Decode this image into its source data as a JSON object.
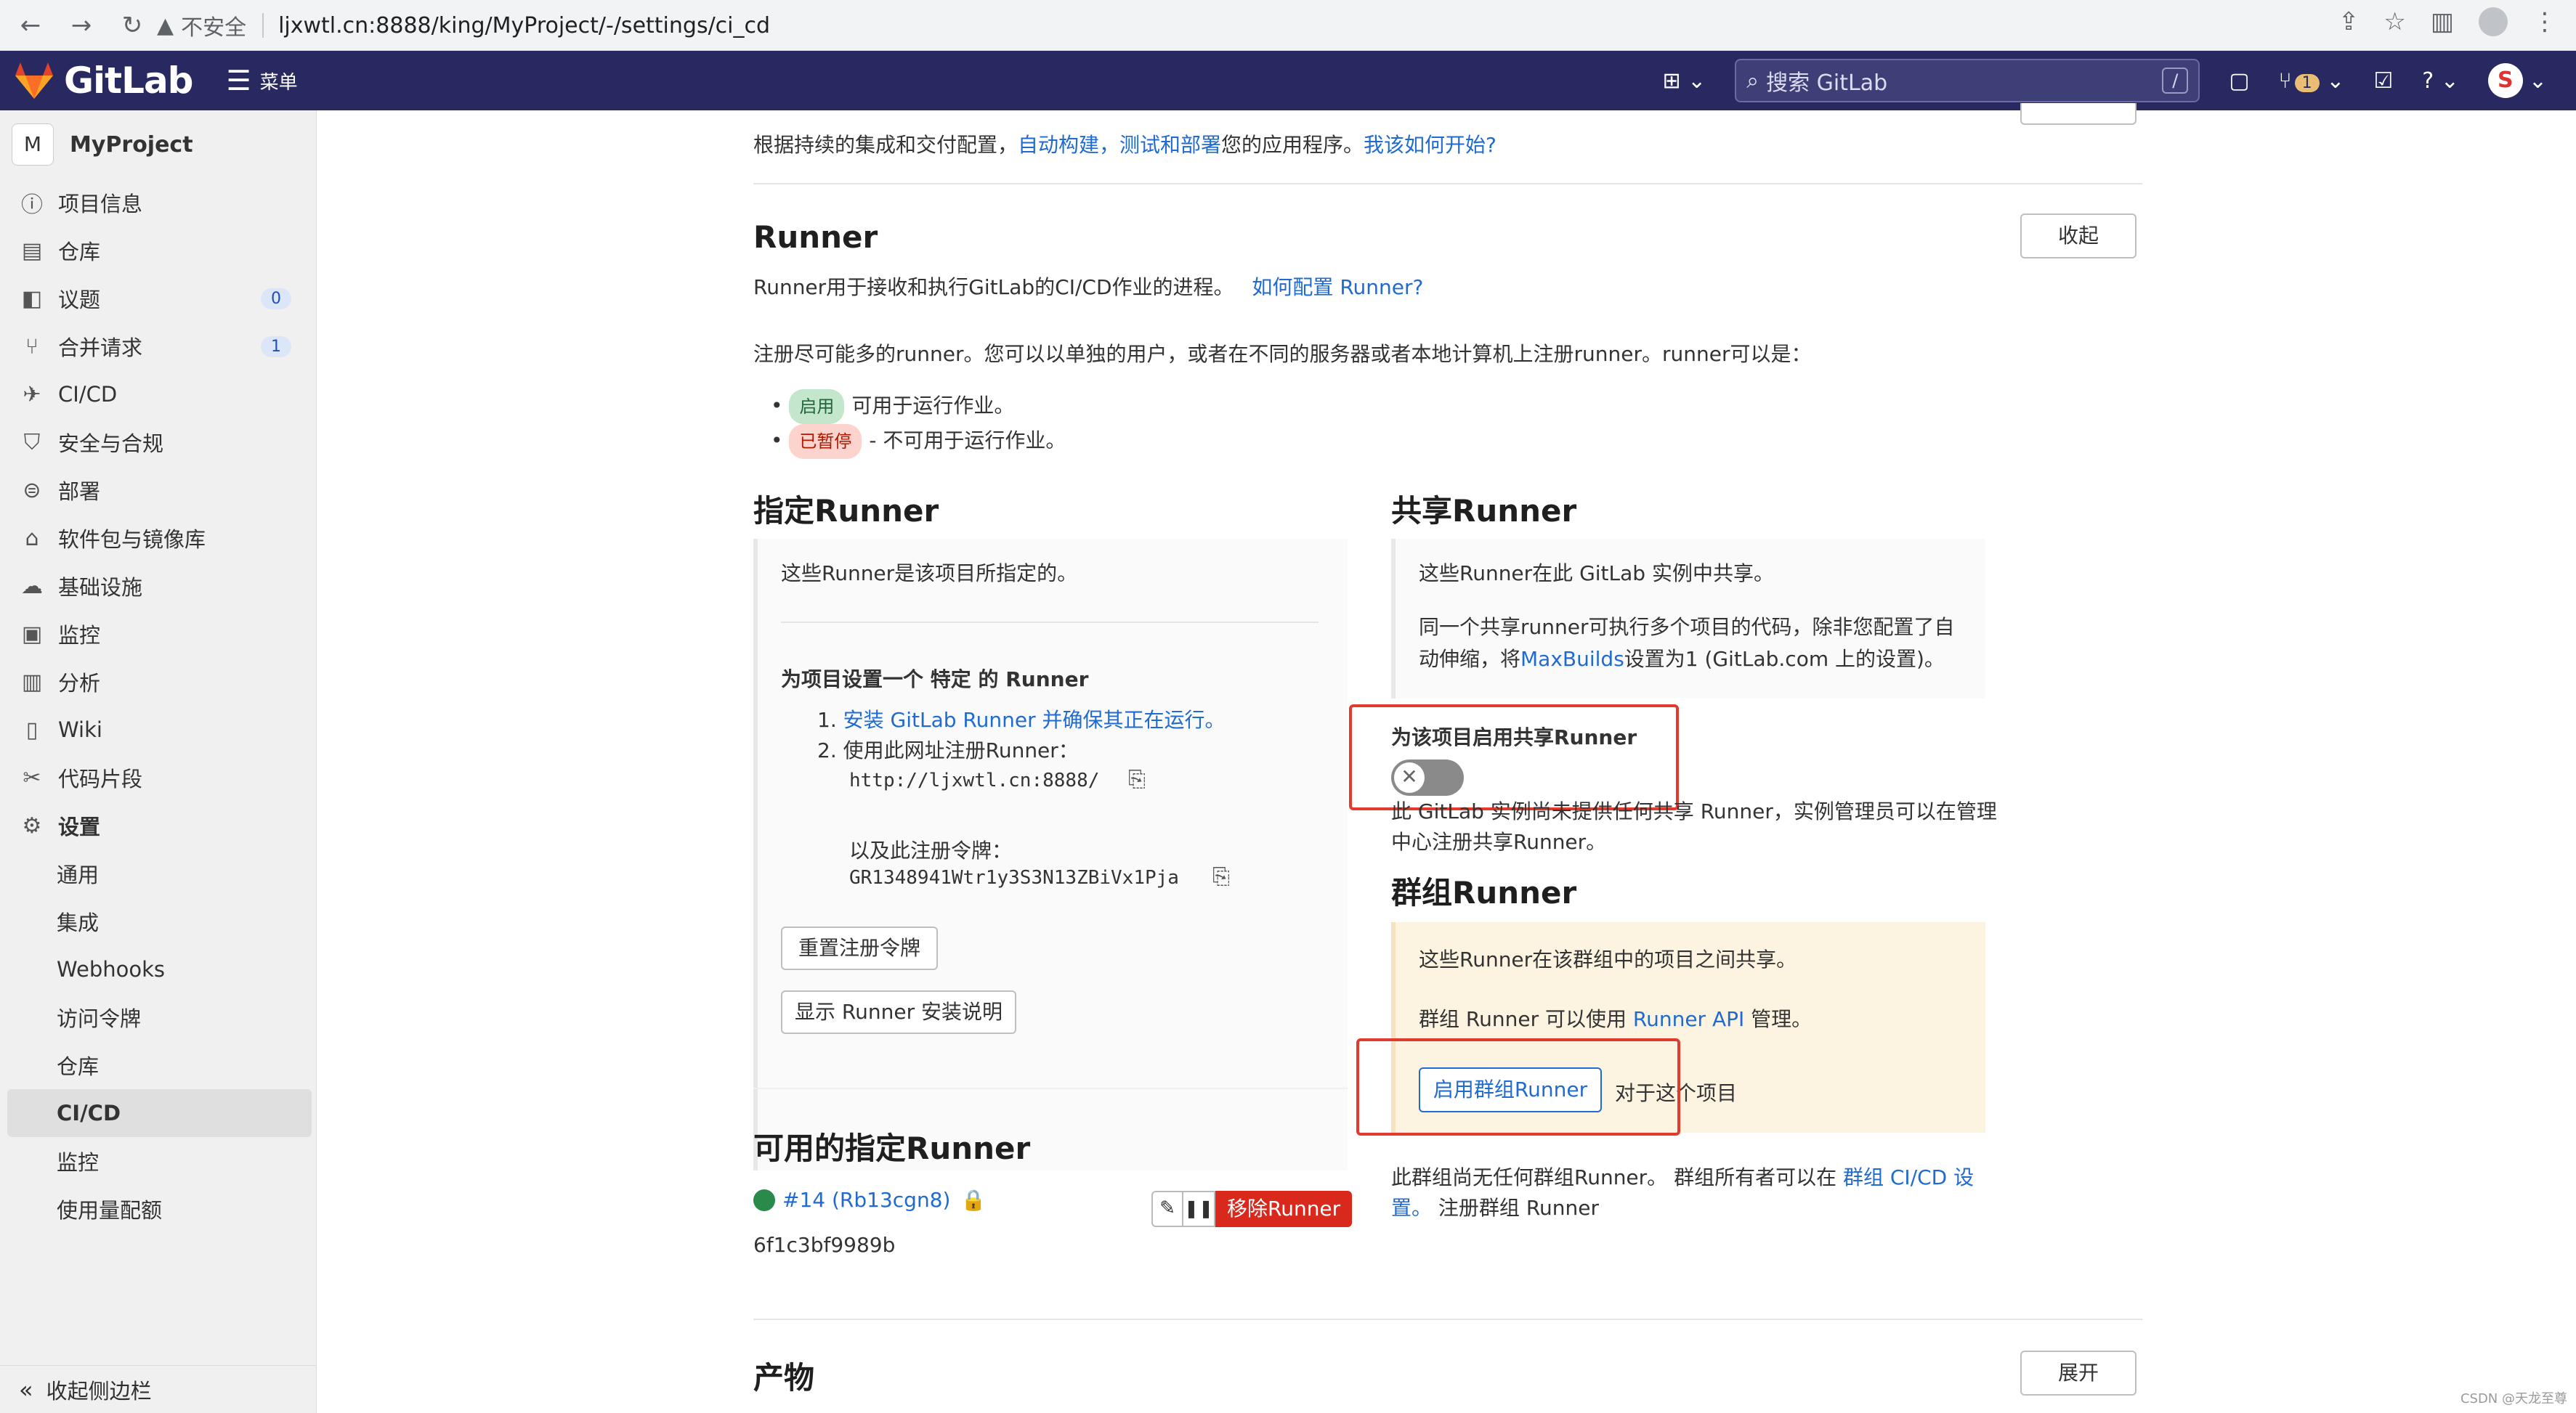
{
  "browser": {
    "security": "不安全",
    "url": "ljxwtl.cn:8888/king/MyProject/-/settings/ci_cd"
  },
  "header": {
    "logo_text": "GitLab",
    "menu_label": "菜单",
    "search_placeholder": "搜索 GitLab",
    "search_shortcut": "/",
    "mr_count": "1",
    "user_initial": "S"
  },
  "sidebar": {
    "project_initial": "M",
    "project_name": "MyProject",
    "items": [
      {
        "label": "项目信息",
        "icon": "info-icon"
      },
      {
        "label": "仓库",
        "icon": "doc-icon"
      },
      {
        "label": "议题",
        "icon": "issues-icon",
        "count": "0"
      },
      {
        "label": "合并请求",
        "icon": "merge-icon",
        "count": "1"
      },
      {
        "label": "CI/CD",
        "icon": "rocket-icon"
      },
      {
        "label": "安全与合规",
        "icon": "shield-icon"
      },
      {
        "label": "部署",
        "icon": "deploy-icon"
      },
      {
        "label": "软件包与镜像库",
        "icon": "package-icon"
      },
      {
        "label": "基础设施",
        "icon": "cloud-icon"
      },
      {
        "label": "监控",
        "icon": "monitor-icon"
      },
      {
        "label": "分析",
        "icon": "chart-icon"
      },
      {
        "label": "Wiki",
        "icon": "book-icon"
      },
      {
        "label": "代码片段",
        "icon": "snippet-icon"
      },
      {
        "label": "设置",
        "icon": "gear-icon"
      }
    ],
    "settings_sub": [
      "通用",
      "集成",
      "Webhooks",
      "访问令牌",
      "仓库",
      "CI/CD",
      "监控",
      "使用量配额"
    ],
    "collapse_label": "收起侧边栏"
  },
  "main": {
    "intro_prefix": "根据持续的集成和交付配置，",
    "intro_link": "自动构建，测试和部署",
    "intro_mid": "您的应用程序。",
    "intro_help": "我该如何开始?",
    "runner_title": "Runner",
    "collapse_btn": "收起",
    "runner_desc": "Runner用于接收和执行GitLab的CI/CD作业的进程。",
    "runner_desc_link": "如何配置 Runner?",
    "runner_register": "注册尽可能多的runner。您可以以单独的用户，或者在不同的服务器或者本地计算机上注册runner。runner可以是：",
    "status_active": "启用",
    "status_active_desc": "可用于运行作业。",
    "status_paused": "已暂停",
    "status_paused_desc": "- 不可用于运行作业。",
    "specific": {
      "title": "指定Runner",
      "desc": "这些Runner是该项目所指定的。",
      "setup_title": "为项目设置一个 特定 的 Runner",
      "step1_num": "1.",
      "step1": "安装 GitLab Runner 并确保其正在运行。",
      "step2_num": "2.",
      "step2": "使用此网址注册Runner：",
      "url": "http://ljxwtl.cn:8888/",
      "token_label": "以及此注册令牌：",
      "token": "GR1348941Wtr1y3S3N13ZBiVx1Pja",
      "reset_btn": "重置注册令牌",
      "show_btn": "显示 Runner 安装说明"
    },
    "available": {
      "title": "可用的指定Runner",
      "runner_link": "#14 (Rb13cgn8)",
      "runner_hash": "6f1c3bf9989b",
      "remove_btn": "移除Runner"
    },
    "shared": {
      "title": "共享Runner",
      "desc1": "这些Runner在此 GitLab 实例中共享。",
      "desc2a": "同一个共享runner可执行多个项目的代码，除非您配置了自",
      "desc2b_pre": "动伸缩，将",
      "desc2b_link": "MaxBuilds",
      "desc2b_post": "设置为1 (GitLab.com 上的设置)。",
      "enable_label": "为该项目启用共享Runner",
      "none_a": "此 GitLab 实例尚未提供任何共享 Runner，实例管理员可以在管理",
      "none_b": "中心注册共享Runner。"
    },
    "group": {
      "title": "群组Runner",
      "desc1": "这些Runner在该群组中的项目之间共享。",
      "desc2_pre": "群组 Runner 可以使用 ",
      "desc2_link": "Runner API",
      "desc2_post": " 管理。",
      "enable_btn": "启用群组Runner",
      "enable_suffix": "对于这个项目",
      "none_pre": "此群组尚无任何群组Runner。 群组所有者可以在 ",
      "none_link_a": "群组 CI/CD 设",
      "none_link_b": "置。",
      "none_post": " 注册群组 Runner"
    },
    "artifacts_title": "产物",
    "expand_btn": "展开"
  },
  "watermark": "CSDN @天龙至尊",
  "colors": {
    "header_bg": "#292961",
    "link": "#1f6bd1",
    "danger": "#d9281c",
    "highlight_box": "#e23b2e",
    "group_panel": "#fdf3e1"
  }
}
